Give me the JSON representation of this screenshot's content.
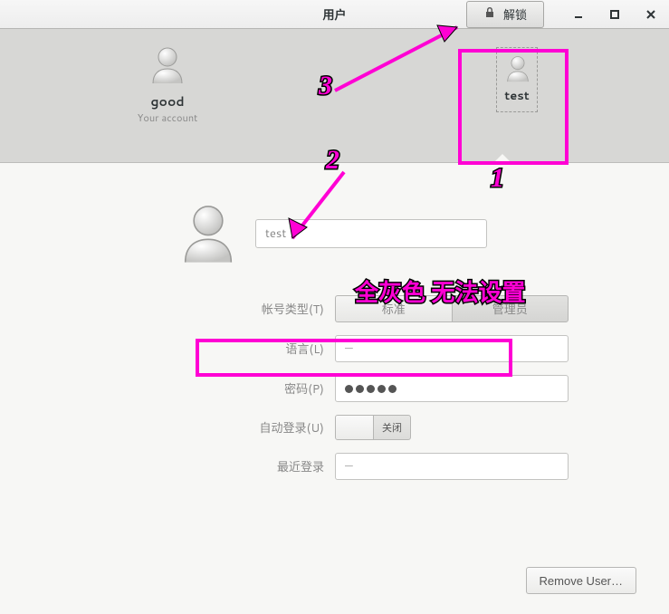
{
  "window": {
    "title": "用户",
    "unlock_label": "解锁"
  },
  "users": {
    "good": {
      "name": "good",
      "subtitle": "Your account"
    },
    "test": {
      "name": "test"
    }
  },
  "detail": {
    "name_value": "test",
    "rows": {
      "account_type": {
        "label": "帐号类型(T)",
        "option_standard": "标准",
        "option_admin": "管理员"
      },
      "language": {
        "label": "语言(L)",
        "value": "—"
      },
      "password": {
        "label": "密码(P)"
      },
      "autologin": {
        "label": "自动登录(U)",
        "switch_label": "关闭"
      },
      "lastlogin": {
        "label": "最近登录",
        "value": "—"
      }
    },
    "remove_label": "Remove User…"
  },
  "annotations": {
    "n1": "1",
    "n2": "2",
    "n3": "3",
    "note": "全灰色 无法设置"
  }
}
